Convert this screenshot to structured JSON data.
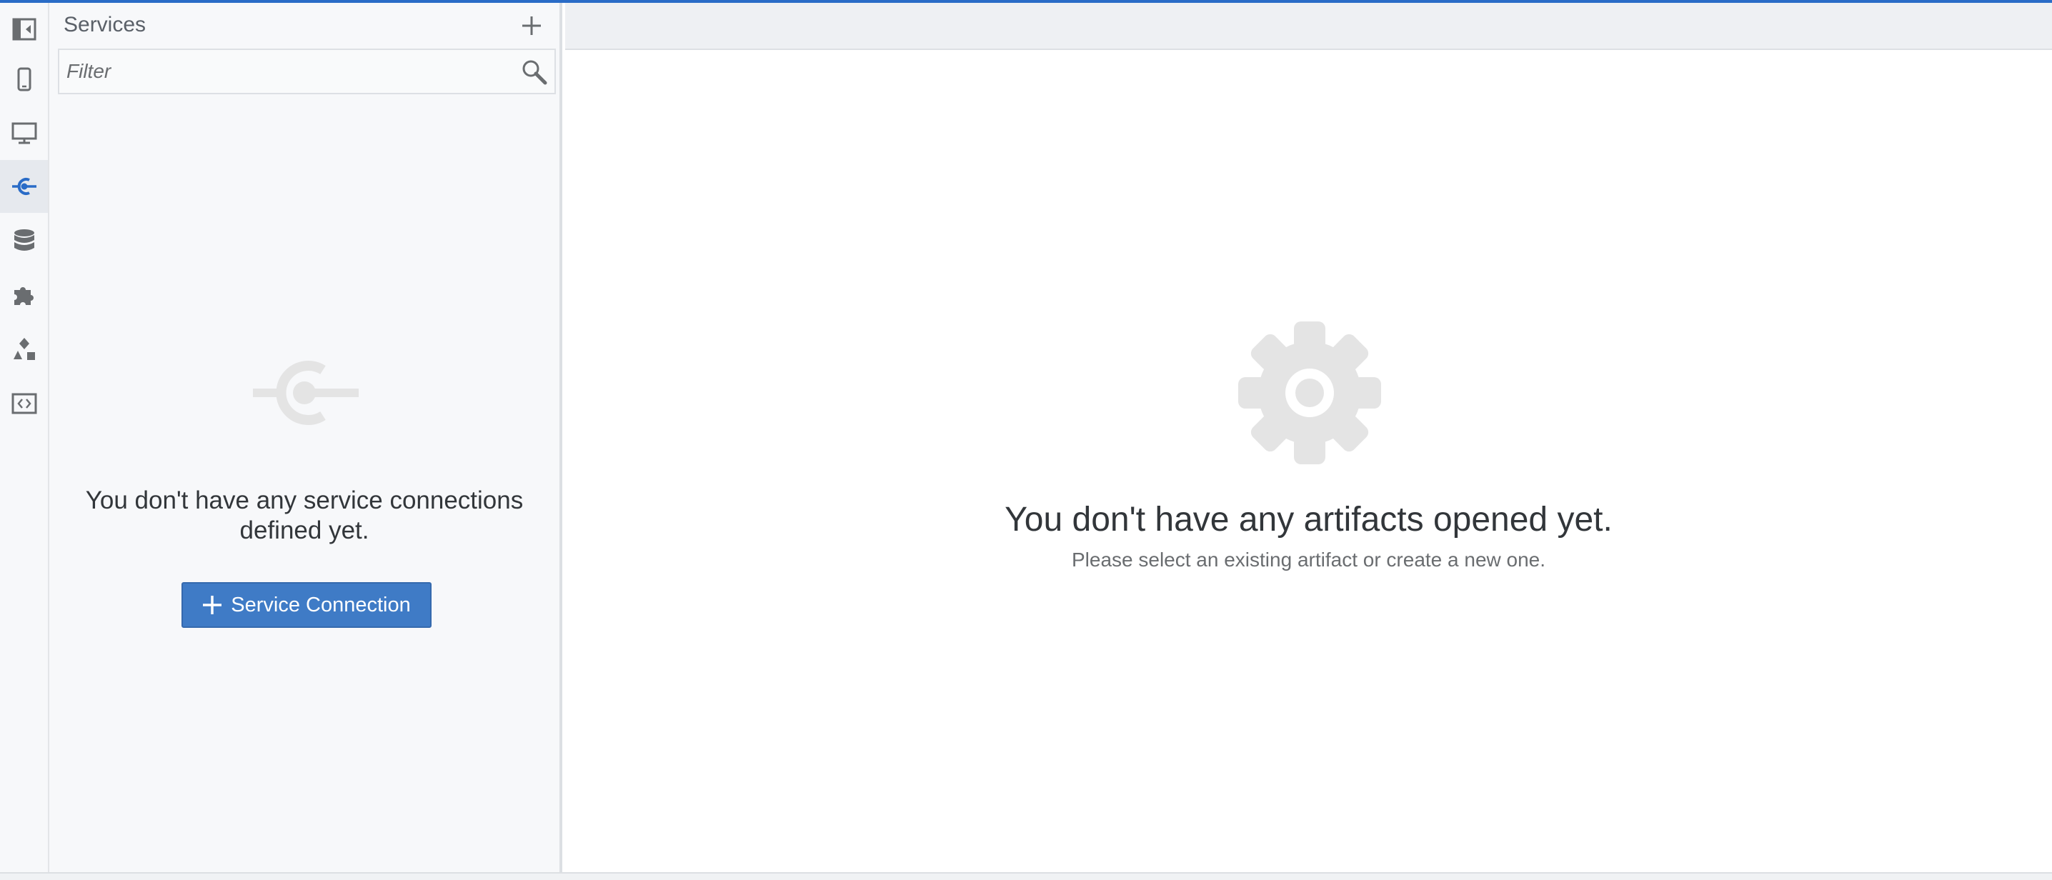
{
  "activity_bar": {
    "items": [
      {
        "name": "sidebar-toggle",
        "icon": "collapse-panel-icon",
        "active": false
      },
      {
        "name": "mobile",
        "icon": "mobile-phone-icon",
        "active": false
      },
      {
        "name": "desktop",
        "icon": "desktop-monitor-icon",
        "active": false
      },
      {
        "name": "services",
        "icon": "service-connection-icon",
        "active": true
      },
      {
        "name": "database",
        "icon": "database-icon",
        "active": false
      },
      {
        "name": "extensions",
        "icon": "puzzle-piece-icon",
        "active": false
      },
      {
        "name": "shapes",
        "icon": "shapes-icon",
        "active": false
      },
      {
        "name": "code",
        "icon": "code-icon",
        "active": false
      }
    ]
  },
  "side_panel": {
    "title": "Services",
    "filter": {
      "placeholder": "Filter",
      "value": ""
    },
    "empty_message": "You don't have any service connections defined yet.",
    "primary_button_label": "Service Connection"
  },
  "editor": {
    "empty_title": "You don't have any artifacts opened yet.",
    "empty_subtitle": "Please select an existing artifact or create a new one."
  },
  "colors": {
    "accent": "#3f7bc6",
    "active_icon": "#2a6cc7",
    "icon": "#6a6d70",
    "placeholder_icon": "#e4e4e4"
  }
}
